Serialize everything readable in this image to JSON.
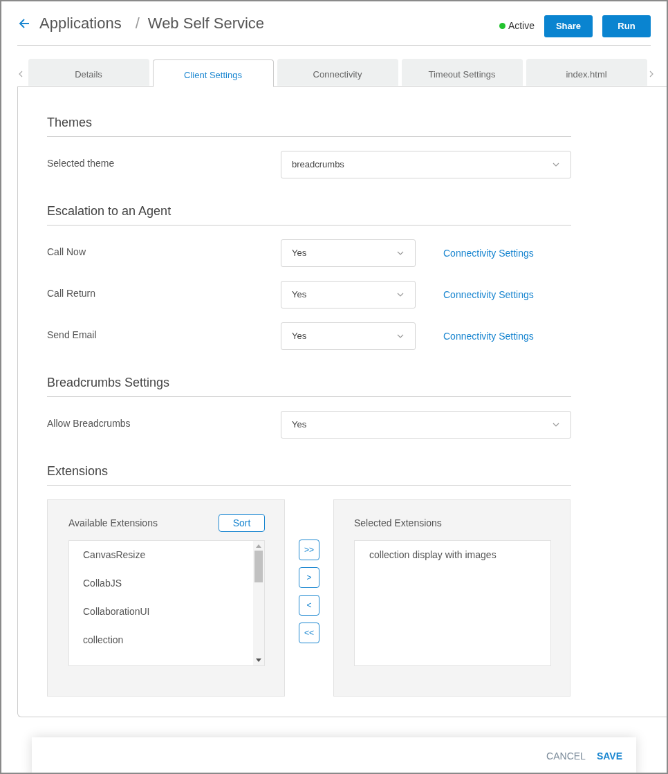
{
  "header": {
    "breadcrumb": [
      "Applications",
      "/",
      "Web Self Service"
    ],
    "status": {
      "label": "Active",
      "color": "#22c32e"
    },
    "buttons": [
      "Share",
      "Run"
    ]
  },
  "tabs": [
    {
      "label": "Details",
      "selected": false
    },
    {
      "label": "Client Settings",
      "selected": true
    },
    {
      "label": "Connectivity",
      "selected": false
    },
    {
      "label": "Timeout Settings",
      "selected": false
    },
    {
      "label": "index.html",
      "selected": false
    }
  ],
  "sections": [
    {
      "title": "Themes",
      "rows": [
        {
          "label": "Selected theme",
          "value": "breadcrumbs",
          "kind": "wide"
        }
      ]
    },
    {
      "title": "Escalation to an Agent",
      "rows": [
        {
          "label": "Call Now",
          "value": "Yes",
          "kind": "narrow",
          "link": "Connectivity Settings"
        },
        {
          "label": "Call Return",
          "value": "Yes",
          "kind": "narrow",
          "link": "Connectivity Settings"
        },
        {
          "label": "Send Email",
          "value": "Yes",
          "kind": "narrow",
          "link": "Connectivity Settings"
        }
      ]
    },
    {
      "title": "Breadcrumbs Settings",
      "rows": [
        {
          "label": "Allow Breadcrumbs",
          "value": "Yes",
          "kind": "wide"
        }
      ]
    }
  ],
  "extensions": {
    "title": "Extensions",
    "available": {
      "title": "Available Extensions",
      "sort": "Sort",
      "items": [
        "CanvasResize",
        "CollabJS",
        "CollaborationUI",
        "collection"
      ]
    },
    "move_buttons": [
      ">>",
      ">",
      "<",
      "<<"
    ],
    "selected": {
      "title": "Selected Extensions",
      "items": [
        "collection display with images"
      ]
    }
  },
  "footer": {
    "cancel": "CANCEL",
    "save": "SAVE"
  }
}
